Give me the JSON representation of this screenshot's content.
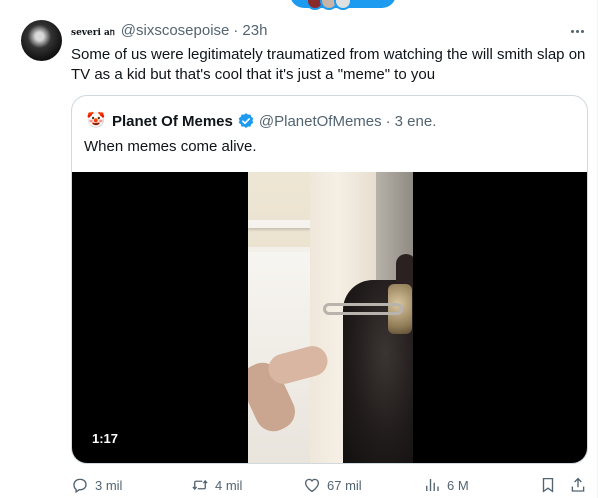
{
  "tweet": {
    "display_name": "severi aᥒ",
    "handle": "@sixscosepoise",
    "separator": "·",
    "time": "23h",
    "text": "Some of us were legitimately traumatized from watching the will smith slap on TV as a kid but that's cool that it's just a \"meme\" to you"
  },
  "quote": {
    "avatar_emoji": "🤡",
    "name": "Planet Of Memes",
    "handle": "@PlanetOfMemes",
    "separator": "·",
    "date": "3 ene.",
    "text": "When memes come alive.",
    "video": {
      "duration": "1:17"
    }
  },
  "actions": {
    "replies": "3 mil",
    "retweets": "4 mil",
    "likes": "67 mil",
    "views": "6 M"
  },
  "icons": [
    "more-icon",
    "verified-icon",
    "reply-icon",
    "retweet-icon",
    "like-icon",
    "views-icon",
    "bookmark-icon",
    "share-icon"
  ],
  "colors": {
    "accent": "#1d9bf0",
    "text": "#0f1419",
    "secondary": "#536471",
    "border": "#cfd9de"
  }
}
